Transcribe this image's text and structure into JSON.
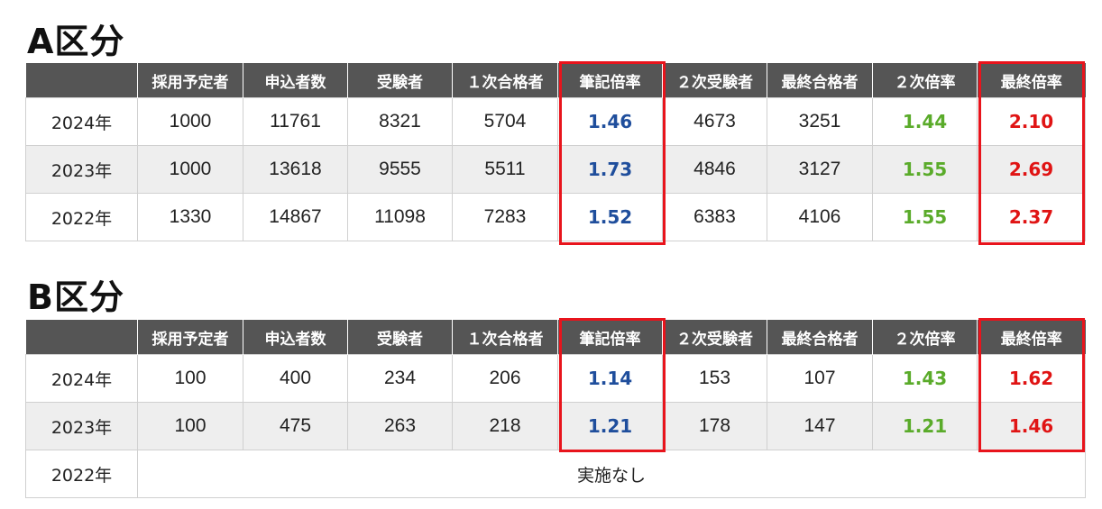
{
  "headers": [
    "",
    "採用予定者",
    "申込者数",
    "受験者",
    "１次合格者",
    "筆記倍率",
    "２次受験者",
    "最終合格者",
    "２次倍率",
    "最終倍率"
  ],
  "colors": {
    "header_bg": "#555555",
    "written_rate": "#1f4e9c",
    "second_rate": "#5aab2a",
    "final_rate": "#e01414",
    "highlight_border": "#e8141c",
    "alt_row_bg": "#eeeeee"
  },
  "section_a": {
    "title": "A区分",
    "rows": [
      {
        "year": "2024年",
        "planned": "1000",
        "applicants": "11761",
        "examinees": "8321",
        "first_pass": "5704",
        "written_rate": "1.46",
        "second_examinees": "4673",
        "final_pass": "3251",
        "second_rate": "1.44",
        "final_rate": "2.10"
      },
      {
        "year": "2023年",
        "planned": "1000",
        "applicants": "13618",
        "examinees": "9555",
        "first_pass": "5511",
        "written_rate": "1.73",
        "second_examinees": "4846",
        "final_pass": "3127",
        "second_rate": "1.55",
        "final_rate": "2.69"
      },
      {
        "year": "2022年",
        "planned": "1330",
        "applicants": "14867",
        "examinees": "11098",
        "first_pass": "7283",
        "written_rate": "1.52",
        "second_examinees": "6383",
        "final_pass": "4106",
        "second_rate": "1.55",
        "final_rate": "2.37"
      }
    ]
  },
  "section_b": {
    "title": "B区分",
    "rows": [
      {
        "year": "2024年",
        "planned": "100",
        "applicants": "400",
        "examinees": "234",
        "first_pass": "206",
        "written_rate": "1.14",
        "second_examinees": "153",
        "final_pass": "107",
        "second_rate": "1.43",
        "final_rate": "1.62"
      },
      {
        "year": "2023年",
        "planned": "100",
        "applicants": "475",
        "examinees": "263",
        "first_pass": "218",
        "written_rate": "1.21",
        "second_examinees": "178",
        "final_pass": "147",
        "second_rate": "1.21",
        "final_rate": "1.46"
      }
    ],
    "no_exam_row": {
      "year": "2022年",
      "note": "実施なし"
    }
  }
}
